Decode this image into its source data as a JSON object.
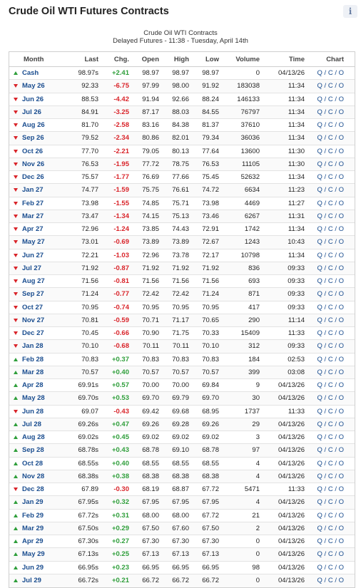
{
  "title": "Crude Oil WTI Futures Contracts",
  "info_label": "i",
  "caption": {
    "line1": "Crude Oil WTI Contracts",
    "line2": "Delayed Futures - 11:38 - Tuesday, April 14th"
  },
  "columns": [
    "Month",
    "Last",
    "Chg.",
    "Open",
    "High",
    "Low",
    "Volume",
    "Time",
    "Chart"
  ],
  "chart_links": "Q / C / O",
  "rows": [
    {
      "month": "Cash",
      "last": "98.97s",
      "chg": "+2.41",
      "dir": "up",
      "open": "98.97",
      "high": "98.97",
      "low": "98.97",
      "volume": "0",
      "time": "04/13/26"
    },
    {
      "month": "May 26",
      "last": "92.33",
      "chg": "-6.75",
      "dir": "down",
      "open": "97.99",
      "high": "98.00",
      "low": "91.92",
      "volume": "183038",
      "time": "11:34"
    },
    {
      "month": "Jun 26",
      "last": "88.53",
      "chg": "-4.42",
      "dir": "down",
      "open": "91.94",
      "high": "92.66",
      "low": "88.24",
      "volume": "146133",
      "time": "11:34"
    },
    {
      "month": "Jul 26",
      "last": "84.91",
      "chg": "-3.25",
      "dir": "down",
      "open": "87.17",
      "high": "88.03",
      "low": "84.55",
      "volume": "76797",
      "time": "11:34"
    },
    {
      "month": "Aug 26",
      "last": "81.70",
      "chg": "-2.58",
      "dir": "down",
      "open": "83.16",
      "high": "84.38",
      "low": "81.37",
      "volume": "37610",
      "time": "11:34"
    },
    {
      "month": "Sep 26",
      "last": "79.52",
      "chg": "-2.34",
      "dir": "down",
      "open": "80.86",
      "high": "82.01",
      "low": "79.34",
      "volume": "36036",
      "time": "11:34"
    },
    {
      "month": "Oct 26",
      "last": "77.70",
      "chg": "-2.21",
      "dir": "down",
      "open": "79.05",
      "high": "80.13",
      "low": "77.64",
      "volume": "13600",
      "time": "11:30"
    },
    {
      "month": "Nov 26",
      "last": "76.53",
      "chg": "-1.95",
      "dir": "down",
      "open": "77.72",
      "high": "78.75",
      "low": "76.53",
      "volume": "11105",
      "time": "11:30"
    },
    {
      "month": "Dec 26",
      "last": "75.57",
      "chg": "-1.77",
      "dir": "down",
      "open": "76.69",
      "high": "77.66",
      "low": "75.45",
      "volume": "52632",
      "time": "11:34"
    },
    {
      "month": "Jan 27",
      "last": "74.77",
      "chg": "-1.59",
      "dir": "down",
      "open": "75.75",
      "high": "76.61",
      "low": "74.72",
      "volume": "6634",
      "time": "11:23"
    },
    {
      "month": "Feb 27",
      "last": "73.98",
      "chg": "-1.55",
      "dir": "down",
      "open": "74.85",
      "high": "75.71",
      "low": "73.98",
      "volume": "4469",
      "time": "11:27"
    },
    {
      "month": "Mar 27",
      "last": "73.47",
      "chg": "-1.34",
      "dir": "down",
      "open": "74.15",
      "high": "75.13",
      "low": "73.46",
      "volume": "6267",
      "time": "11:31"
    },
    {
      "month": "Apr 27",
      "last": "72.96",
      "chg": "-1.24",
      "dir": "down",
      "open": "73.85",
      "high": "74.43",
      "low": "72.91",
      "volume": "1742",
      "time": "11:34"
    },
    {
      "month": "May 27",
      "last": "73.01",
      "chg": "-0.69",
      "dir": "down",
      "open": "73.89",
      "high": "73.89",
      "low": "72.67",
      "volume": "1243",
      "time": "10:43"
    },
    {
      "month": "Jun 27",
      "last": "72.21",
      "chg": "-1.03",
      "dir": "down",
      "open": "72.96",
      "high": "73.78",
      "low": "72.17",
      "volume": "10798",
      "time": "11:34"
    },
    {
      "month": "Jul 27",
      "last": "71.92",
      "chg": "-0.87",
      "dir": "down",
      "open": "71.92",
      "high": "71.92",
      "low": "71.92",
      "volume": "836",
      "time": "09:33"
    },
    {
      "month": "Aug 27",
      "last": "71.56",
      "chg": "-0.81",
      "dir": "down",
      "open": "71.56",
      "high": "71.56",
      "low": "71.56",
      "volume": "693",
      "time": "09:33"
    },
    {
      "month": "Sep 27",
      "last": "71.24",
      "chg": "-0.77",
      "dir": "down",
      "open": "72.42",
      "high": "72.42",
      "low": "71.24",
      "volume": "871",
      "time": "09:33"
    },
    {
      "month": "Oct 27",
      "last": "70.95",
      "chg": "-0.74",
      "dir": "down",
      "open": "70.95",
      "high": "70.95",
      "low": "70.95",
      "volume": "417",
      "time": "09:33"
    },
    {
      "month": "Nov 27",
      "last": "70.81",
      "chg": "-0.59",
      "dir": "down",
      "open": "70.71",
      "high": "71.17",
      "low": "70.65",
      "volume": "290",
      "time": "11:14"
    },
    {
      "month": "Dec 27",
      "last": "70.45",
      "chg": "-0.66",
      "dir": "down",
      "open": "70.90",
      "high": "71.75",
      "low": "70.33",
      "volume": "15409",
      "time": "11:33"
    },
    {
      "month": "Jan 28",
      "last": "70.10",
      "chg": "-0.68",
      "dir": "down",
      "open": "70.11",
      "high": "70.11",
      "low": "70.10",
      "volume": "312",
      "time": "09:33"
    },
    {
      "month": "Feb 28",
      "last": "70.83",
      "chg": "+0.37",
      "dir": "up",
      "open": "70.83",
      "high": "70.83",
      "low": "70.83",
      "volume": "184",
      "time": "02:53"
    },
    {
      "month": "Mar 28",
      "last": "70.57",
      "chg": "+0.40",
      "dir": "up",
      "open": "70.57",
      "high": "70.57",
      "low": "70.57",
      "volume": "399",
      "time": "03:08"
    },
    {
      "month": "Apr 28",
      "last": "69.91s",
      "chg": "+0.57",
      "dir": "up",
      "open": "70.00",
      "high": "70.00",
      "low": "69.84",
      "volume": "9",
      "time": "04/13/26"
    },
    {
      "month": "May 28",
      "last": "69.70s",
      "chg": "+0.53",
      "dir": "up",
      "open": "69.70",
      "high": "69.79",
      "low": "69.70",
      "volume": "30",
      "time": "04/13/26"
    },
    {
      "month": "Jun 28",
      "last": "69.07",
      "chg": "-0.43",
      "dir": "down",
      "open": "69.42",
      "high": "69.68",
      "low": "68.95",
      "volume": "1737",
      "time": "11:33"
    },
    {
      "month": "Jul 28",
      "last": "69.26s",
      "chg": "+0.47",
      "dir": "up",
      "open": "69.26",
      "high": "69.28",
      "low": "69.26",
      "volume": "29",
      "time": "04/13/26"
    },
    {
      "month": "Aug 28",
      "last": "69.02s",
      "chg": "+0.45",
      "dir": "up",
      "open": "69.02",
      "high": "69.02",
      "low": "69.02",
      "volume": "3",
      "time": "04/13/26"
    },
    {
      "month": "Sep 28",
      "last": "68.78s",
      "chg": "+0.43",
      "dir": "up",
      "open": "68.78",
      "high": "69.10",
      "low": "68.78",
      "volume": "97",
      "time": "04/13/26"
    },
    {
      "month": "Oct 28",
      "last": "68.55s",
      "chg": "+0.40",
      "dir": "up",
      "open": "68.55",
      "high": "68.55",
      "low": "68.55",
      "volume": "4",
      "time": "04/13/26"
    },
    {
      "month": "Nov 28",
      "last": "68.38s",
      "chg": "+0.38",
      "dir": "up",
      "open": "68.38",
      "high": "68.38",
      "low": "68.38",
      "volume": "4",
      "time": "04/13/26"
    },
    {
      "month": "Dec 28",
      "last": "67.89",
      "chg": "-0.30",
      "dir": "down",
      "open": "68.19",
      "high": "68.87",
      "low": "67.72",
      "volume": "5471",
      "time": "11:33"
    },
    {
      "month": "Jan 29",
      "last": "67.95s",
      "chg": "+0.32",
      "dir": "up",
      "open": "67.95",
      "high": "67.95",
      "low": "67.95",
      "volume": "4",
      "time": "04/13/26"
    },
    {
      "month": "Feb 29",
      "last": "67.72s",
      "chg": "+0.31",
      "dir": "up",
      "open": "68.00",
      "high": "68.00",
      "low": "67.72",
      "volume": "21",
      "time": "04/13/26"
    },
    {
      "month": "Mar 29",
      "last": "67.50s",
      "chg": "+0.29",
      "dir": "up",
      "open": "67.50",
      "high": "67.60",
      "low": "67.50",
      "volume": "2",
      "time": "04/13/26"
    },
    {
      "month": "Apr 29",
      "last": "67.30s",
      "chg": "+0.27",
      "dir": "up",
      "open": "67.30",
      "high": "67.30",
      "low": "67.30",
      "volume": "0",
      "time": "04/13/26"
    },
    {
      "month": "May 29",
      "last": "67.13s",
      "chg": "+0.25",
      "dir": "up",
      "open": "67.13",
      "high": "67.13",
      "low": "67.13",
      "volume": "0",
      "time": "04/13/26"
    },
    {
      "month": "Jun 29",
      "last": "66.95s",
      "chg": "+0.23",
      "dir": "up",
      "open": "66.95",
      "high": "66.95",
      "low": "66.95",
      "volume": "98",
      "time": "04/13/26"
    },
    {
      "month": "Jul 29",
      "last": "66.72s",
      "chg": "+0.21",
      "dir": "up",
      "open": "66.72",
      "high": "66.72",
      "low": "66.72",
      "volume": "0",
      "time": "04/13/26"
    }
  ]
}
